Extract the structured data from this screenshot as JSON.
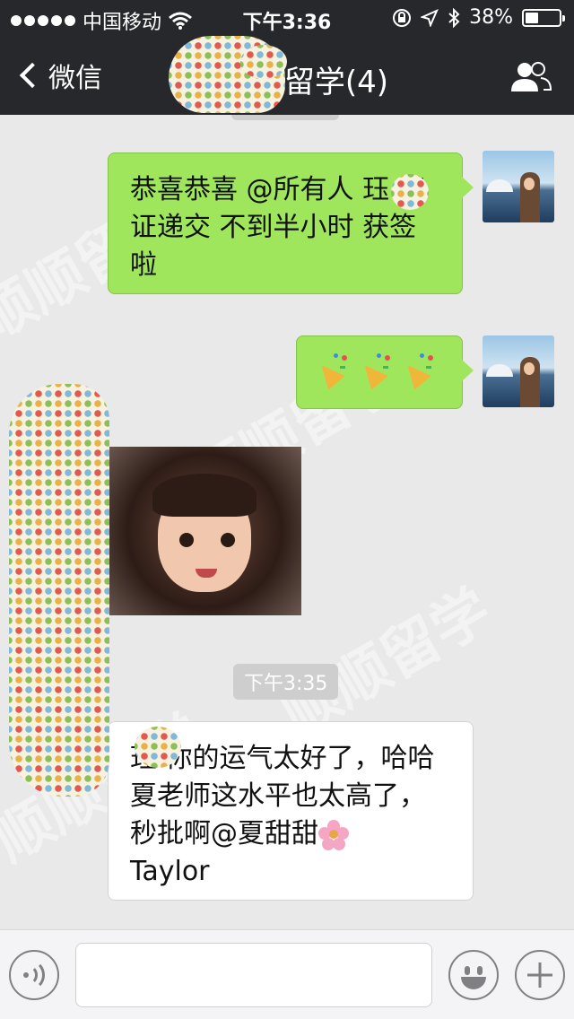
{
  "status_bar": {
    "carrier": "中国移动",
    "time": "下午3:36",
    "battery": "38%",
    "battery_level": 0.38
  },
  "nav": {
    "back_label": "微信",
    "title": "留学(4)"
  },
  "watermark": "顺顺留学",
  "messages": {
    "m1_text": "恭喜恭喜 @所有人  珏 签证递交 不到半小时 获签啦",
    "m2_text": "🎉🎉🎉",
    "time_pill": "下午3:35",
    "m4_text": "珏 你的运气太好了，哈哈夏老师这水平也太高了，秒批啊@夏甜甜",
    "m4_name": "Taylor"
  },
  "colors": {
    "bubble_green": "#9fe65d",
    "bar_dark": "#27282c",
    "background": "#e9e9e9"
  },
  "icons": {
    "wifi": "wifi-icon",
    "lock": "orientation-lock-icon",
    "location": "location-icon",
    "bluetooth": "bluetooth-icon",
    "group": "group-members-icon",
    "voice": "voice-icon",
    "emoji": "emoji-icon",
    "plus": "plus-icon"
  }
}
